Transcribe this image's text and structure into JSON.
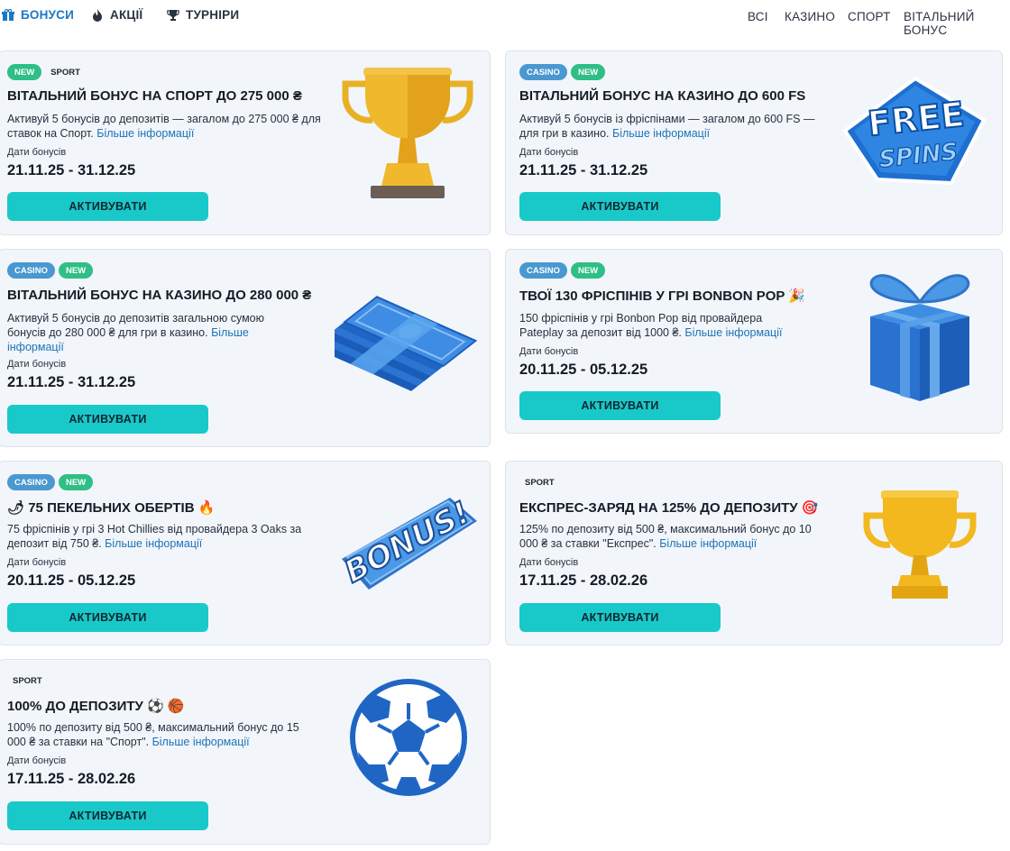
{
  "nav": {
    "tabs": [
      {
        "label": "БОНУСИ",
        "icon": "gift-icon",
        "active": true
      },
      {
        "label": "АКЦІЇ",
        "icon": "flame-icon",
        "active": false
      },
      {
        "label": "ТУРНІРИ",
        "icon": "trophy-icon",
        "active": false
      }
    ],
    "filters": [
      "ВСІ",
      "КАЗИНО",
      "СПОРТ",
      "ВІТАЛЬНИЙ БОНУС"
    ]
  },
  "colors": {
    "accent": "#19c9c9",
    "link": "#1e73b8",
    "active_tab": "#1b78c4",
    "badge_new": "#2fbf86",
    "badge_casino": "#4a98d0"
  },
  "cards": [
    {
      "badges": [
        "NEW",
        "SPORT"
      ],
      "title": "ВІТАЛЬНИЙ БОНУС НА СПОРТ ДО 275 000 ₴",
      "desc": "Активуй 5 бонусів до депозитів — загалом до 275 000 ₴ для ставок на Спорт.",
      "more": "Більше інформації",
      "date_label": "Дати бонусів",
      "dates": "21.11.25 - 31.12.25",
      "button": "АКТИВУВАТИ",
      "image": "gold-trophy"
    },
    {
      "badges": [
        "CASINO",
        "NEW"
      ],
      "title": "ВІТАЛЬНИЙ БОНУС НА КАЗИНО ДО 600 FS",
      "desc": "Активуй 5 бонусів із фріспінами — загалом до 600 FS — для гри в казино.",
      "more": "Більше інформації",
      "date_label": "Дати бонусів",
      "dates": "21.11.25 - 31.12.25",
      "button": "АКТИВУВАТИ",
      "image": "free-spins",
      "image_text_1": "FREE",
      "image_text_2": "SPINS"
    },
    {
      "badges": [
        "CASINO",
        "NEW"
      ],
      "title": "ВІТАЛЬНИЙ БОНУС НА КАЗИНО ДО 280 000 ₴",
      "desc": "Активуй 5 бонусів до депозитів загальною сумою бонусів до 280 000 ₴ для гри в казино.",
      "more": "Більше інформації",
      "date_label": "Дати бонусів",
      "dates": "21.11.25 - 31.12.25",
      "button": "АКТИВУВАТИ",
      "image": "money-stack"
    },
    {
      "badges": [
        "CASINO",
        "NEW"
      ],
      "title": "ТВОЇ 130 ФРІСПІНІВ У ГРІ BONBON POP 🎉",
      "desc": "150 фріспінів у грі Bonbon Pop від провайдера Pateplay за депозит від 1000 ₴.",
      "more": "Більше інформації",
      "date_label": "Дати бонусів",
      "dates": "20.11.25 - 05.12.25",
      "button": "АКТИВУВАТИ",
      "image": "gift-box"
    },
    {
      "badges": [
        "CASINO",
        "NEW"
      ],
      "title": "🌶 75 ПЕКЕЛЬНИХ ОБЕРТІВ 🔥",
      "desc": "75 фріспінів у грі 3 Hot Chillies від провайдера 3 Oaks за депозит від 750 ₴.",
      "more": "Більше інформації",
      "date_label": "Дати бонусів",
      "dates": "20.11.25 - 05.12.25",
      "button": "АКТИВУВАТИ",
      "image": "bonus-sign",
      "image_text": "BONUS!"
    },
    {
      "badges": [
        "SPORT"
      ],
      "title": "ЕКСПРЕС-ЗАРЯД НА 125% ДО ДЕПОЗИТУ 🎯",
      "desc": "125% по депозиту від 500 ₴, максимальний бонус до 10 000 ₴ за ставки \"Експрес\".",
      "more": "Більше інформації",
      "date_label": "Дати бонусів",
      "dates": "17.11.25 - 28.02.26",
      "button": "АКТИВУВАТИ",
      "image": "gold-trophy-small"
    },
    {
      "badges": [
        "SPORT"
      ],
      "title": "100% ДО ДЕПОЗИТУ ⚽ 🏀",
      "desc": "100% по депозиту від 500 ₴, максимальний бонус до 15 000 ₴ за ставки на \"Спорт\".",
      "more": "Більше інформації",
      "date_label": "Дати бонусів",
      "dates": "17.11.25 - 28.02.26",
      "button": "АКТИВУВАТИ",
      "image": "soccer-ball"
    }
  ]
}
